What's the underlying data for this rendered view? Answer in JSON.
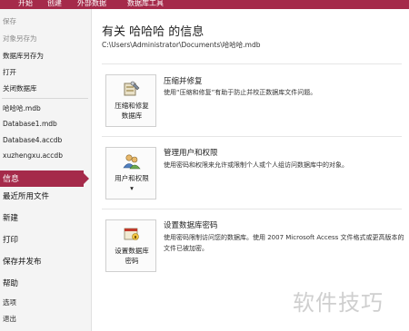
{
  "ribbon": {
    "tabs": [
      "开始",
      "创建",
      "外部数据",
      "数据库工具"
    ],
    "color": "#a52a4a"
  },
  "sidebar": {
    "items": [
      {
        "label": "保存",
        "style": "dim"
      },
      {
        "label": "对象另存为",
        "style": "dim"
      },
      {
        "label": "数据库另存为",
        "style": "normal"
      },
      {
        "label": "打开",
        "style": "normal"
      },
      {
        "label": "关闭数据库",
        "style": "normal"
      },
      {
        "label": "哈哈哈.mdb",
        "style": "normal"
      },
      {
        "label": "Database1.mdb",
        "style": "normal"
      },
      {
        "label": "Database4.accdb",
        "style": "normal"
      },
      {
        "label": "xuzhengxu.accdb",
        "style": "normal"
      },
      {
        "label": "信息",
        "style": "active"
      },
      {
        "label": "最近所用文件",
        "style": "big"
      },
      {
        "label": "新建",
        "style": "big"
      },
      {
        "label": "打印",
        "style": "big"
      },
      {
        "label": "保存并发布",
        "style": "big"
      },
      {
        "label": "帮助",
        "style": "big"
      },
      {
        "label": "选项",
        "style": "normal"
      },
      {
        "label": "退出",
        "style": "normal"
      }
    ]
  },
  "main": {
    "title": "有关 哈哈哈 的信息",
    "path": "C:\\Users\\Administrator\\Documents\\哈哈哈.mdb",
    "sections": [
      {
        "button_label": "压缩和修复\n数据库",
        "icon": "compact-repair-icon",
        "title": "压缩并修复",
        "description": "使用“压缩和修复”有助于防止并校正数据库文件问题。"
      },
      {
        "button_label": "用户和权限\n▾",
        "icon": "users-permissions-icon",
        "title": "管理用户和权限",
        "description": "使用密码和权限来允许或限制个人或个人组访问数据库中的对象。"
      },
      {
        "button_label": "设置数据库\n密码",
        "icon": "database-password-icon",
        "title": "设置数据库密码",
        "description": "使用密码限制访问您的数据库。使用 2007 Microsoft Access 文件格式或更高版本的文件已被加密。"
      }
    ]
  },
  "watermark": "软件技巧"
}
